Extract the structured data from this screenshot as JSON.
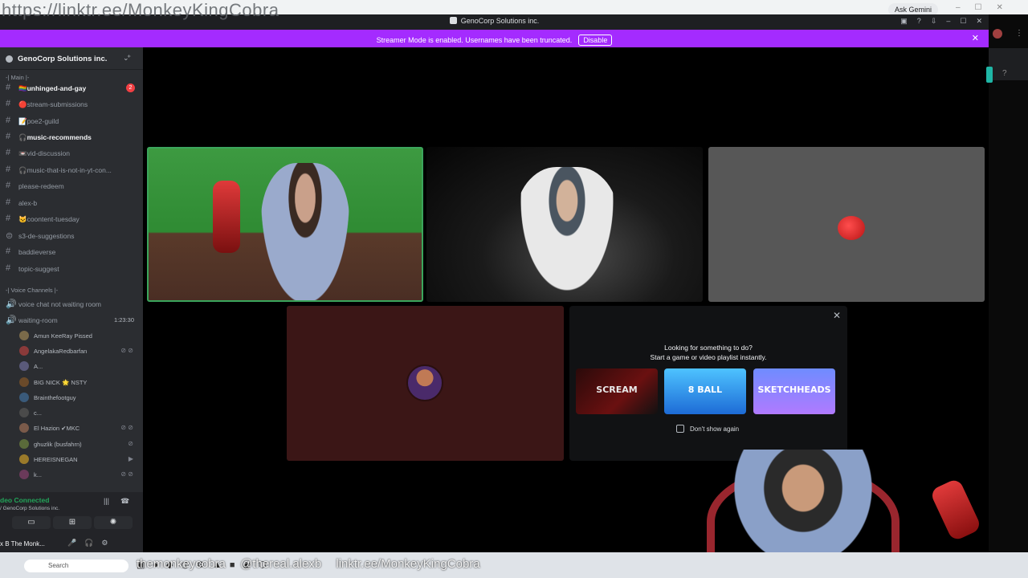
{
  "overlay": {
    "top_url": "https://linktr.ee/MonkeyKingCobra",
    "bottom_handles": [
      "themonkeycobra",
      "@thereal.alexb",
      "linktr.ee/MonkeyKingCobra"
    ]
  },
  "browser": {
    "ask_gemini": "Ask Gemini"
  },
  "window": {
    "title": "GenoCorp Solutions inc."
  },
  "banner": {
    "text": "Streamer Mode is enabled. Usernames have been truncated.",
    "button": "Disable"
  },
  "server": {
    "name": "GenoCorp Solutions inc."
  },
  "categories": {
    "main": "-| Main |-",
    "voice": "-| Voice Channels |-"
  },
  "channels": [
    {
      "name": "🏳️‍🌈unhinged-and-gay",
      "badge": "2",
      "bold": true
    },
    {
      "name": "🔴stream-submissions"
    },
    {
      "name": "📝poe2-guild"
    },
    {
      "name": "🎧music-recommends",
      "bold": true
    },
    {
      "name": "📼vid-discussion"
    },
    {
      "name": "🎧music-that-is-not-in-yt-con..."
    },
    {
      "name": "please-redeem"
    },
    {
      "name": "alex-b"
    },
    {
      "name": "🐱coontent-tuesday"
    },
    {
      "name": "s3-de-suggestions"
    },
    {
      "name": "baddieverse"
    },
    {
      "name": "topic-suggest"
    }
  ],
  "voice_channels": [
    {
      "name": "voice chat not waiting room"
    },
    {
      "name": "waiting-room",
      "time": "1:23:30"
    }
  ],
  "voice_users": [
    {
      "name": "Amun KeeRay Pissed",
      "color": "#7a6a4a"
    },
    {
      "name": "AngelakaRedbarfan",
      "color": "#8a3a3a"
    },
    {
      "name": "A...",
      "color": "#5a5a7a"
    },
    {
      "name": "BIG NICK 🌟 NSTY",
      "color": "#6a4a2a"
    },
    {
      "name": "Brainthefootguy",
      "color": "#3a5a7a"
    },
    {
      "name": "c...",
      "color": "#4a4a4a"
    },
    {
      "name": "El Hazion ✔MKC",
      "color": "#7a5a4a"
    },
    {
      "name": "ghuzlik (busfahrn)",
      "color": "#5a6a3a"
    },
    {
      "name": "HEREISNEGAN",
      "color": "#9a7a2a"
    },
    {
      "name": "k...",
      "color": "#6a3a5a"
    }
  ],
  "voice_panel": {
    "status": "deo Connected",
    "sub": "/ GenoCorp Solutions inc.",
    "user": "x B The Monk..."
  },
  "activity": {
    "title_line1": "Looking for something to do?",
    "title_line2": "Start a game or video playlist instantly.",
    "games": [
      "SCREAM",
      "8 BALL",
      "SKETCHHEADS"
    ],
    "dont_show": "Don't show again"
  },
  "taskbar": {
    "search": "Search"
  },
  "colors": {
    "banner": "#a42bff",
    "speaking": "#3ba55c",
    "sidebar": "#2b2d31",
    "badge": "#f23f43"
  }
}
